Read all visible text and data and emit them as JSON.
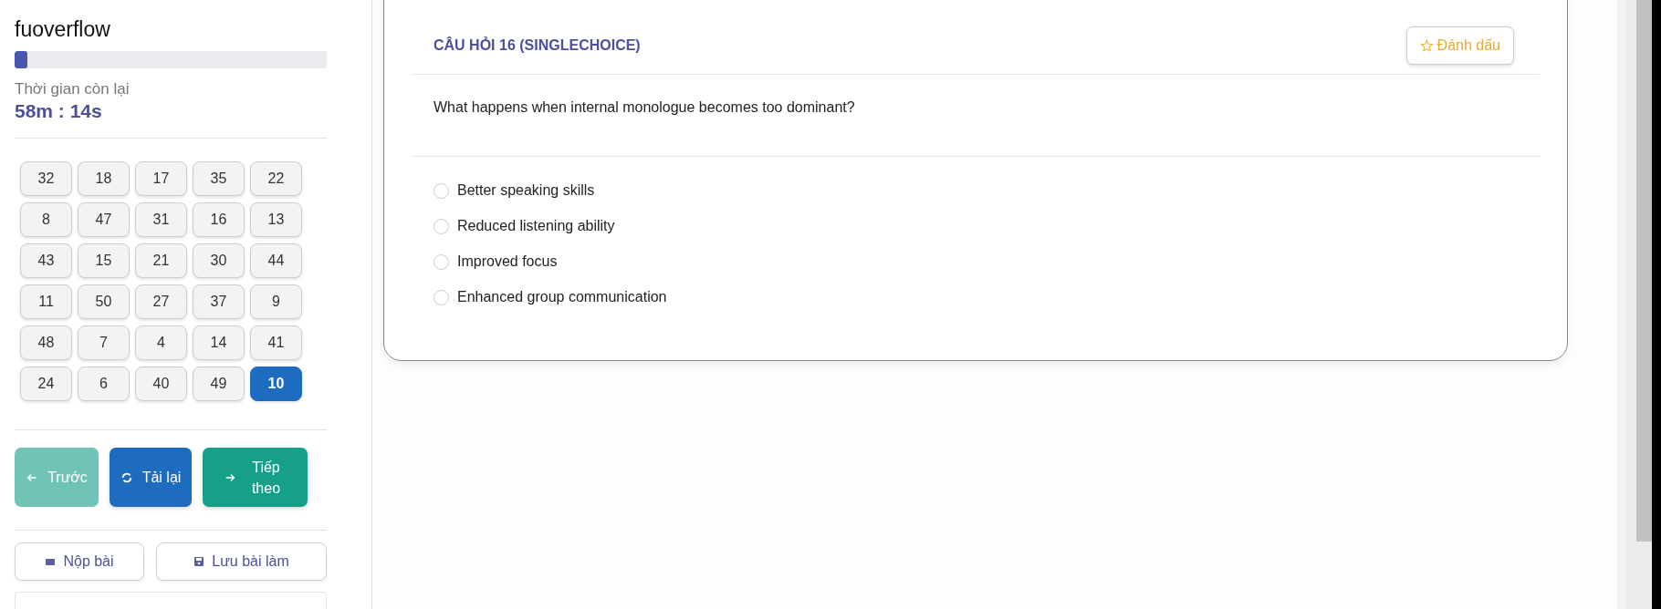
{
  "sidebar": {
    "title": "fuoverflow",
    "progress": {
      "level": 0.04
    },
    "timer": {
      "label": "Thời gian còn lại",
      "value": "58m : 14s"
    },
    "questions": [
      {
        "label": "32",
        "selected": false
      },
      {
        "label": "18",
        "selected": false
      },
      {
        "label": "17",
        "selected": false
      },
      {
        "label": "35",
        "selected": false
      },
      {
        "label": "22",
        "selected": false
      },
      {
        "label": "8",
        "selected": false
      },
      {
        "label": "47",
        "selected": false
      },
      {
        "label": "31",
        "selected": false
      },
      {
        "label": "16",
        "selected": false
      },
      {
        "label": "13",
        "selected": false
      },
      {
        "label": "43",
        "selected": false
      },
      {
        "label": "15",
        "selected": false
      },
      {
        "label": "21",
        "selected": false
      },
      {
        "label": "30",
        "selected": false
      },
      {
        "label": "44",
        "selected": false
      },
      {
        "label": "11",
        "selected": false
      },
      {
        "label": "50",
        "selected": false
      },
      {
        "label": "27",
        "selected": false
      },
      {
        "label": "37",
        "selected": false
      },
      {
        "label": "9",
        "selected": false
      },
      {
        "label": "48",
        "selected": false
      },
      {
        "label": "7",
        "selected": false
      },
      {
        "label": "4",
        "selected": false
      },
      {
        "label": "14",
        "selected": false
      },
      {
        "label": "41",
        "selected": false
      },
      {
        "label": "24",
        "selected": false
      },
      {
        "label": "6",
        "selected": false
      },
      {
        "label": "40",
        "selected": false
      },
      {
        "label": "49",
        "selected": false
      },
      {
        "label": "10",
        "selected": true
      }
    ],
    "nav_buttons": [
      {
        "kind": "prev",
        "label": "Trước",
        "disabled": true
      },
      {
        "kind": "reload",
        "label": "Tải lại",
        "disabled": false
      },
      {
        "kind": "next",
        "label": "Tiếp theo",
        "disabled": false
      }
    ],
    "actions": [
      {
        "kind": "submit",
        "label": "Nộp bài"
      },
      {
        "kind": "save",
        "label": "Lưu bài làm"
      }
    ]
  },
  "question": {
    "heading": "CÂU HỎI 16 (SINGLECHOICE)",
    "flag_button": "Đánh dấu",
    "text": "What happens when internal monologue becomes too dominant?",
    "options": [
      {
        "label": "Better speaking skills",
        "selected": false
      },
      {
        "label": "Reduced listening ability",
        "selected": false
      },
      {
        "label": "Improved focus",
        "selected": false
      },
      {
        "label": "Enhanced group communication",
        "selected": false
      }
    ]
  }
}
